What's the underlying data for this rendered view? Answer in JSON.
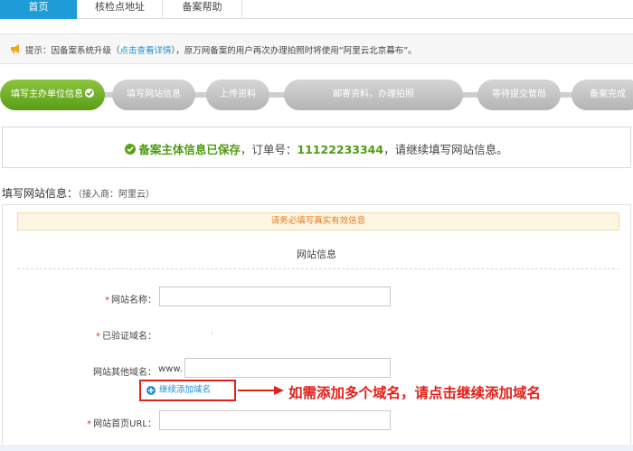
{
  "tabs": [
    {
      "label": "首页"
    },
    {
      "label": "核检点地址"
    },
    {
      "label": "备案帮助"
    }
  ],
  "tip": {
    "prefix": "提示：因备案系统升级（",
    "link": "点击查看详情",
    "suffix": "），原万网备案的用户再次办理拍照时将使用“阿里云北京幕布”。"
  },
  "steps": [
    {
      "label": "填写主办单位信息"
    },
    {
      "label": "填写网站信息"
    },
    {
      "label": "上传资料"
    },
    {
      "label": "邮寄资料，办理拍照"
    },
    {
      "label": "等待提交管局"
    },
    {
      "label": "备案完成"
    }
  ],
  "saved": {
    "status": "备案主体信息已保存",
    "order_label": "，订单号：",
    "order_no": "11122233344",
    "suffix": "，请继续填写网站信息。"
  },
  "section": {
    "title": "填写网站信息：",
    "provider": "（接入商：阿里云）"
  },
  "form": {
    "notice": "请务必填写真实有效信息",
    "heading": "网站信息",
    "site_name_label": "网站名称：",
    "site_name_value": "",
    "verified_domain_label": "已验证域名：",
    "verified_domain_value": ".",
    "other_domain_label": "网站其他域名：",
    "other_domain_prefix": "www.",
    "other_domain_value": "",
    "add_domain": "继续添加域名",
    "homepage_label": "网站首页URL：",
    "homepage_value": ""
  },
  "annotation": {
    "text": "如需添加多个域名，请点击继续添加域名",
    "color": "#e0201a"
  },
  "colors": {
    "tab_active": "#1d9cd8",
    "step_active": "#6aaf1e",
    "required": "#e0301e",
    "link": "#1d8fd6"
  }
}
